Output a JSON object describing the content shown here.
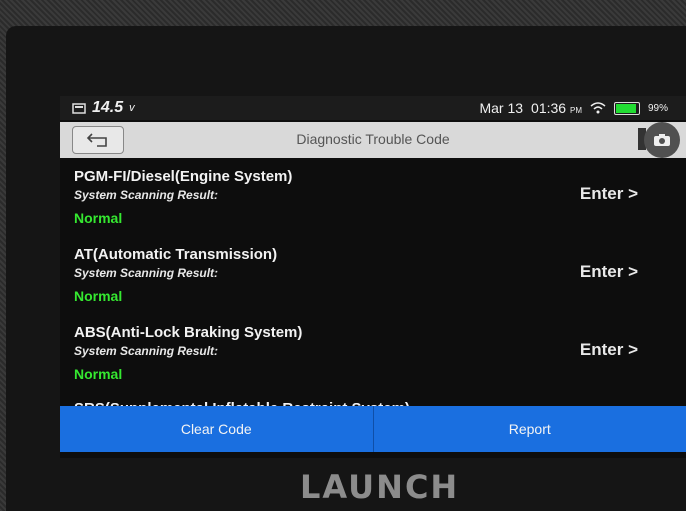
{
  "status_bar": {
    "voltage": "14.5",
    "voltage_unit": "v",
    "date": "Mar 13",
    "time": "01:36",
    "time_suffix": "PM",
    "battery_percent": "99%"
  },
  "title_bar": {
    "title": "Diagnostic Trouble Code"
  },
  "systems": [
    {
      "name": "PGM-FI/Diesel(Engine System)",
      "result_label": "System Scanning Result:",
      "result": "Normal",
      "action": "Enter >"
    },
    {
      "name": "AT(Automatic Transmission)",
      "result_label": "System Scanning Result:",
      "result": "Normal",
      "action": "Enter >"
    },
    {
      "name": "ABS(Anti-Lock Braking System)",
      "result_label": "System Scanning Result:",
      "result": "Normal",
      "action": "Enter >"
    },
    {
      "name": "SRS(Supplemental Inflatable Restraint System)"
    }
  ],
  "bottom_bar": {
    "clear_label": "Clear Code",
    "report_label": "Report"
  },
  "device": {
    "brand": "LAUNCH"
  },
  "colors": {
    "accent_blue": "#1a6fe0",
    "status_green": "#35e830",
    "battery_green": "#22dd33"
  }
}
